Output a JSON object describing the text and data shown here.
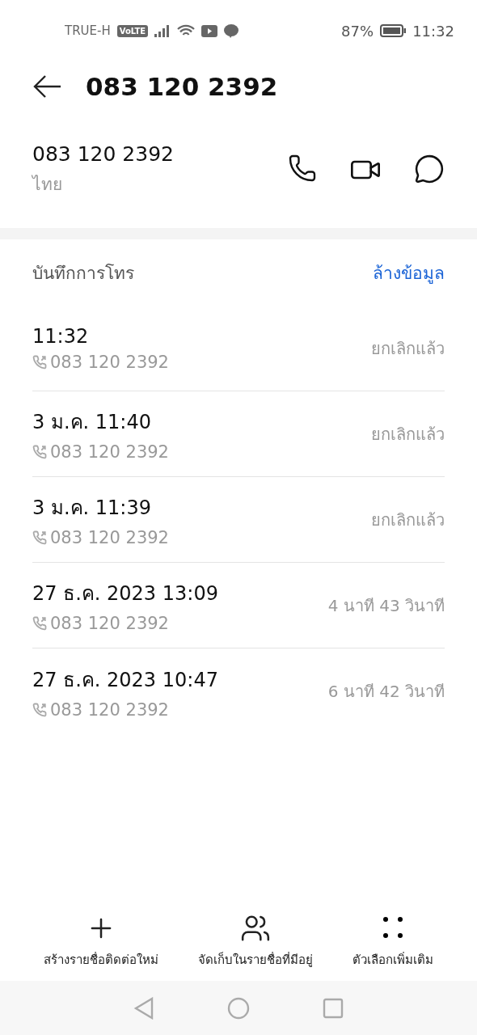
{
  "status_bar": {
    "carrier": "TRUE-H",
    "volte": "VoLTE",
    "battery": "87%",
    "time": "11:32"
  },
  "header": {
    "title": "083 120 2392"
  },
  "contact": {
    "number": "083 120 2392",
    "region": "ไทย"
  },
  "call_log": {
    "title": "บันทึกการโทร",
    "clear": "ล้างข้อมูล",
    "rows": [
      {
        "time": "11:32",
        "number": "083 120 2392",
        "result": "ยกเลิกแล้ว"
      },
      {
        "time": "3 ม.ค. 11:40",
        "number": "083 120 2392",
        "result": "ยกเลิกแล้ว"
      },
      {
        "time": "3 ม.ค. 11:39",
        "number": "083 120 2392",
        "result": "ยกเลิกแล้ว"
      },
      {
        "time": "27 ธ.ค. 2023 13:09",
        "number": "083 120 2392",
        "result": "4 นาที 43 วินาที"
      },
      {
        "time": "27 ธ.ค. 2023 10:47",
        "number": "083 120 2392",
        "result": "6 นาที 42 วินาที"
      }
    ]
  },
  "actions": [
    {
      "kind": "add",
      "label": "สร้างรายชื่อติดต่อใหม่"
    },
    {
      "kind": "save",
      "label": "จัดเก็บในรายชื่อที่มีอยู่"
    },
    {
      "kind": "more",
      "label": "ตัวเลือกเพิ่มเติม"
    }
  ]
}
